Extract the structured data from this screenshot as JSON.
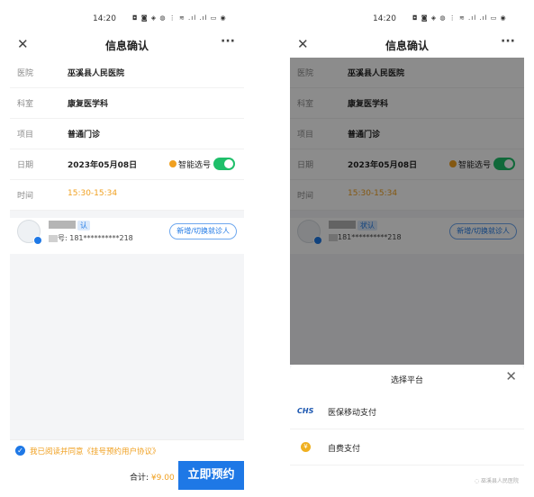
{
  "status_bar": {
    "time": "14:20",
    "icons": "◘ ◙ ◈ ◍ ⋮ ≋ .ıl .ıl ▭ ◉"
  },
  "nav": {
    "title": "信息确认",
    "close": "✕",
    "more": "···"
  },
  "info": [
    {
      "label": "医院",
      "value": "巫溪县人民医院"
    },
    {
      "label": "科室",
      "value": "康复医学科"
    },
    {
      "label": "项目",
      "value": "普通门诊"
    },
    {
      "label": "日期",
      "value": "2023年05月08日"
    },
    {
      "label": "时间",
      "value": "15:30-15:34"
    }
  ],
  "smart_pick": {
    "label": "智能选号",
    "enabled": true
  },
  "patient": {
    "tag": "认",
    "tag_right": "状认",
    "id_left": "号: 181**********218",
    "id_right": "181**********218"
  },
  "switch_button": "新增/切换就诊人",
  "agreement": {
    "check": "✓",
    "text": "我已阅读并同意《挂号预约用户协议》"
  },
  "footer": {
    "total_label": "合计:",
    "total_value": "¥9.00",
    "book_button": "立即预约"
  },
  "sheet": {
    "title": "选择平台",
    "close": "✕",
    "options": [
      {
        "icon": "CHS",
        "label": "医保移动支付"
      },
      {
        "icon": "¥",
        "label": "自费支付"
      }
    ],
    "watermark": "◌ 巫溪县人民医院"
  },
  "colors": {
    "primary": "#1e78e6",
    "accent": "#f0a020",
    "toggle": "#1fbf6a"
  }
}
